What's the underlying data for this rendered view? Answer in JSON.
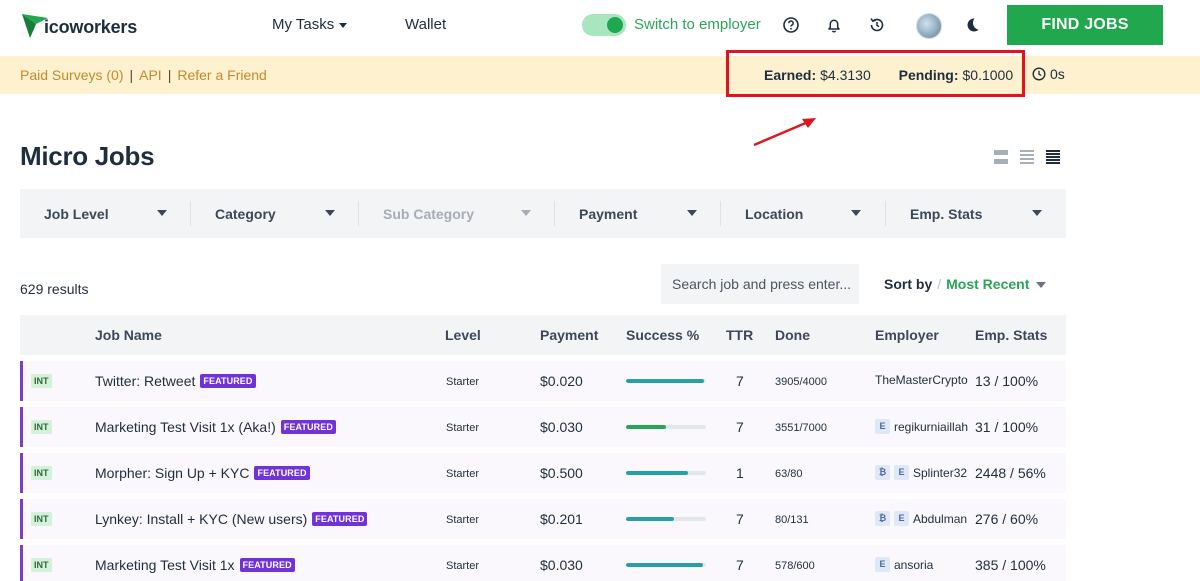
{
  "nav": {
    "logo_text": "icoworkers",
    "my_tasks": "My Tasks",
    "wallet": "Wallet",
    "switch_label": "Switch to employer",
    "find_jobs": "FIND JOBS",
    "icons": [
      "help-icon",
      "bell-icon",
      "history-icon",
      "avatar",
      "moon-icon"
    ]
  },
  "subbar": {
    "links": [
      "Paid Surveys (0)",
      "API",
      "Refer a Friend"
    ],
    "separator": "|",
    "earned_label": "Earned:",
    "earned_value": "$4.3130",
    "pending_label": "Pending:",
    "pending_value": "$0.1000",
    "timer": "0s"
  },
  "page": {
    "title": "Micro Jobs",
    "results": "629 results",
    "search_placeholder": "Search job and press enter...",
    "sort_label": "Sort by",
    "sort_value": "Most Recent"
  },
  "filters": [
    "Job Level",
    "Category",
    "Sub Category",
    "Payment",
    "Location",
    "Emp. Stats"
  ],
  "table": {
    "headers": [
      "Job Name",
      "Level",
      "Payment",
      "Success %",
      "TTR",
      "Done",
      "Employer",
      "Emp. Stats"
    ],
    "rows": [
      {
        "badge": "INT",
        "name": "Twitter: Retweet",
        "featured": "FEATURED",
        "level": "Starter",
        "payment": "$0.020",
        "success": 0.98,
        "bar_color": "#26a0a8",
        "ttr": "7",
        "done": "3905/4000",
        "employer_badges": [],
        "employer": "TheMasterCrypto",
        "emp_stats": "13 / 100%"
      },
      {
        "badge": "INT",
        "name": "Marketing Test Visit 1x (Aka!)",
        "featured": "FEATURED",
        "level": "Starter",
        "payment": "$0.030",
        "success": 0.5,
        "bar_color": "#2aa556",
        "ttr": "7",
        "done": "3551/7000",
        "employer_badges": [
          "E"
        ],
        "employer": "regikurniaillah",
        "emp_stats": "31 / 100%"
      },
      {
        "badge": "INT",
        "name": "Morpher: Sign Up + KYC",
        "featured": "FEATURED",
        "level": "Starter",
        "payment": "$0.500",
        "success": 0.78,
        "bar_color": "#26a0a8",
        "ttr": "1",
        "done": "63/80",
        "employer_badges": [
          "₿",
          "E"
        ],
        "employer": "Splinter32",
        "emp_stats": "2448 / 56%"
      },
      {
        "badge": "INT",
        "name": "Lynkey: Install + KYC (New users)",
        "featured": "FEATURED",
        "level": "Starter",
        "payment": "$0.201",
        "success": 0.6,
        "bar_color": "#26a0a8",
        "ttr": "7",
        "done": "80/131",
        "employer_badges": [
          "₿",
          "E"
        ],
        "employer": "Abdulman",
        "emp_stats": "276 / 60%"
      },
      {
        "badge": "INT",
        "name": "Marketing Test Visit 1x",
        "featured": "FEATURED",
        "level": "Starter",
        "payment": "$0.030",
        "success": 0.96,
        "bar_color": "#26a0a8",
        "ttr": "7",
        "done": "578/600",
        "employer_badges": [
          "E"
        ],
        "employer": "ansoria",
        "emp_stats": "385 / 100%"
      }
    ]
  },
  "colors": {
    "accent_green": "#21a84e",
    "subbar_bg": "#fdf1cf",
    "featured": "#7133d6",
    "annotation_red": "#e0141c"
  }
}
